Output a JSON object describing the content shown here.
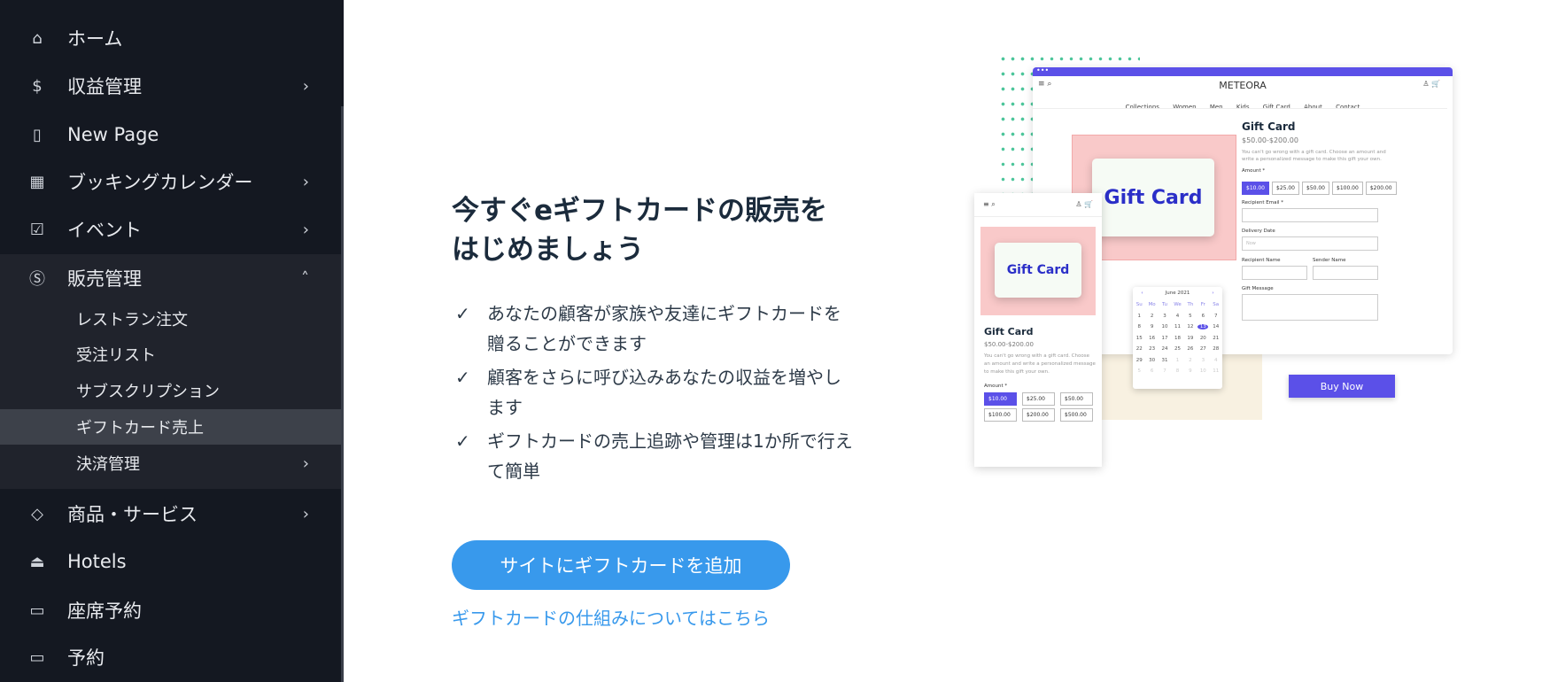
{
  "sidebar": {
    "items": [
      {
        "label": "ホーム",
        "icon": "home-icon"
      },
      {
        "label": "収益管理",
        "icon": "revenue-icon"
      },
      {
        "label": "New Page",
        "icon": "page-icon"
      },
      {
        "label": "ブッキングカレンダー",
        "icon": "calendar-icon"
      },
      {
        "label": "イベント",
        "icon": "event-icon"
      },
      {
        "label": "販売管理",
        "icon": "dollar-circle-icon"
      },
      {
        "label": "商品・サービス",
        "icon": "tags-icon"
      },
      {
        "label": "Hotels",
        "icon": "bell-icon"
      },
      {
        "label": "座席予約",
        "icon": "ticket-icon"
      },
      {
        "label": "予約",
        "icon": "ticket-icon"
      }
    ],
    "sub_items": [
      {
        "label": "レストラン注文"
      },
      {
        "label": "受注リスト"
      },
      {
        "label": "サブスクリプション"
      },
      {
        "label": "ギフトカード売上",
        "active": true
      },
      {
        "label": "決済管理"
      }
    ]
  },
  "main": {
    "title_line1": "今すぐeギフトカードの販売を",
    "title_line2": "はじめましょう",
    "bullets": [
      "あなたの顧客が家族や友達にギフトカードを贈ることができます",
      "顧客をさらに呼び込みあなたの収益を増やします",
      "ギフトカードの売上追跡や管理は1か所で行えて簡単"
    ],
    "cta_label": "サイトにギフトカードを追加",
    "learn_link": "ギフトカードの仕組みについてはこちら"
  },
  "mockup": {
    "brand": "METEORA",
    "nav": [
      "Collections",
      "Women",
      "Men",
      "Kids",
      "Gift Card",
      "About",
      "Contact"
    ],
    "card_text": "Gift Card",
    "product_title": "Gift Card",
    "price": "$50.00-$200.00",
    "desc_desktop": "You can't go wrong with a gift card. Choose an amount and write a personalized message to make this gift your own.",
    "desc_mobile": "You can't go wrong with a gift card. Choose an amount and write a personalized message to make this gift your own.",
    "amount_label": "Amount *",
    "amounts_desktop": [
      "$10.00",
      "$25.00",
      "$50.00",
      "$100.00",
      "$200.00"
    ],
    "amounts_mobile": [
      "$10.00",
      "$25.00",
      "$50.00",
      "$100.00",
      "$200.00",
      "$500.00"
    ],
    "recipient_email": "Recipient Email *",
    "delivery_date": "Delivery Date",
    "delivery_placeholder": "Now",
    "recipient_name": "Recipient Name",
    "sender_name": "Sender Name",
    "gift_message": "Gift Message",
    "buy_now": "Buy Now",
    "calendar": {
      "month": "June 2021",
      "weekdays": [
        "Su",
        "Mo",
        "Tu",
        "We",
        "Th",
        "Fr",
        "Sa"
      ],
      "rows": [
        [
          "1",
          "2",
          "3",
          "4",
          "5",
          "6",
          "7"
        ],
        [
          "8",
          "9",
          "10",
          "11",
          "12",
          "13",
          "14"
        ],
        [
          "15",
          "16",
          "17",
          "18",
          "19",
          "20",
          "21"
        ],
        [
          "22",
          "23",
          "24",
          "25",
          "26",
          "27",
          "28"
        ],
        [
          "29",
          "30",
          "31",
          "1",
          "2",
          "3",
          "4"
        ],
        [
          "5",
          "6",
          "7",
          "8",
          "9",
          "10",
          "11"
        ]
      ],
      "selected": "13"
    },
    "accent": "#5b50e8"
  },
  "colors": {
    "sidebar_bg": "#141821",
    "cta": "#3899ec",
    "title": "#1b2b3c"
  }
}
